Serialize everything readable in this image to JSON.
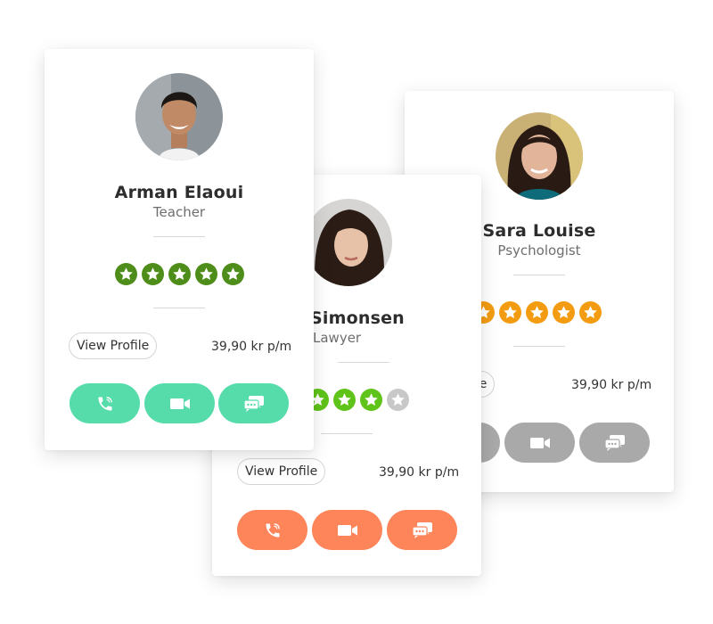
{
  "cards": [
    {
      "name": "Arman Elaoui",
      "role": "Teacher",
      "rating": 5,
      "rating_max": 5,
      "star_color": "#4e8d1a",
      "view_profile_label": "View Profile",
      "price": "39,90 kr p/m",
      "action_color": "#56dcab",
      "actions": [
        "call-icon",
        "video-icon",
        "chat-icon"
      ]
    },
    {
      "name": "Simonsen",
      "role": "Lawyer",
      "rating": 4,
      "rating_max": 5,
      "star_color": "#5fc319",
      "star_empty_color": "#c8c8c8",
      "view_profile_label": "View Profile",
      "price": "39,90 kr p/m",
      "action_color": "#fe8459",
      "actions": [
        "call-icon",
        "video-icon",
        "chat-icon"
      ]
    },
    {
      "name": "Sara Louise",
      "role": "Psychologist",
      "rating": 5,
      "rating_max": 5,
      "star_color": "#f39c12",
      "view_profile_label": "rofile",
      "price": "39,90 kr p/m",
      "action_color": "#a9a9a9",
      "actions": [
        "call-icon",
        "video-icon",
        "chat-icon"
      ]
    }
  ]
}
